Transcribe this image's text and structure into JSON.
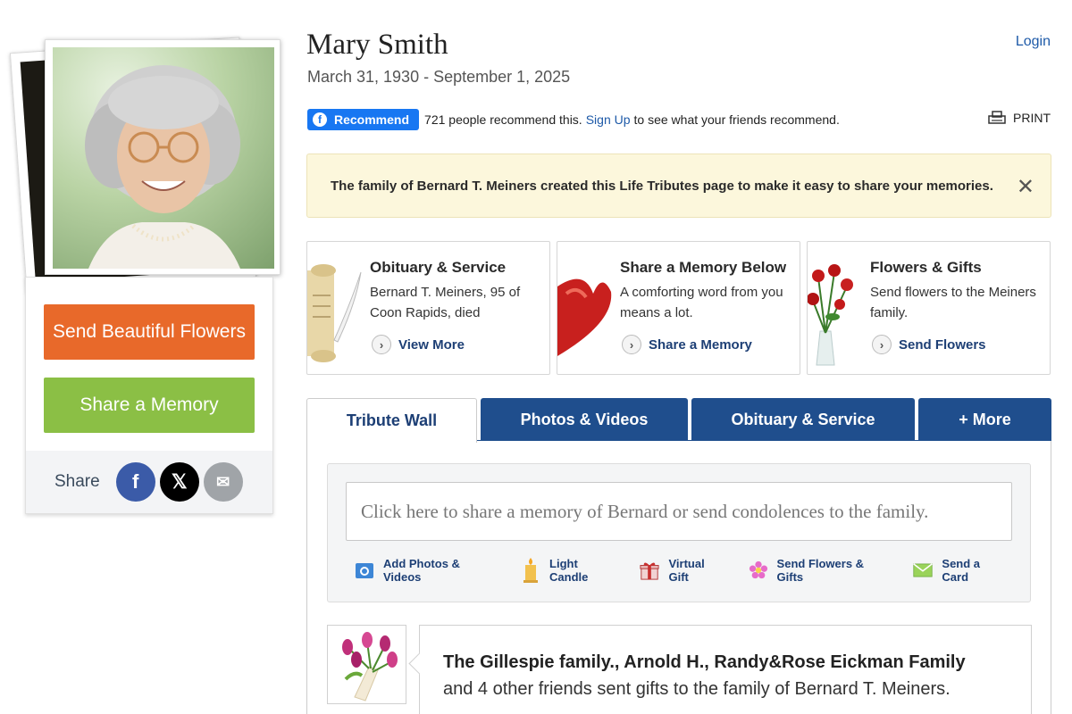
{
  "header": {
    "name": "Mary Smith",
    "dates": "March 31, 1930 - September 1, 2025",
    "login": "Login",
    "print": "PRINT"
  },
  "recommend": {
    "button": "Recommend",
    "text": "721 people recommend this.",
    "signup": "Sign Up",
    "suffix": "to see what your friends recommend."
  },
  "notice": {
    "text": "The family of Bernard T. Meiners created this Life Tributes page to make it easy to share your memories."
  },
  "sidebar": {
    "send_flowers": "Send Beautiful Flowers",
    "share_memory": "Share a Memory",
    "share_label": "Share"
  },
  "cards": [
    {
      "title": "Obituary & Service",
      "desc": "Bernard T. Meiners, 95 of Coon Rapids, died",
      "link": "View More",
      "icon": "scroll-quill-image"
    },
    {
      "title": "Share a Memory Below",
      "desc": "A comforting word from you means a lot.",
      "link": "Share a Memory",
      "icon": "red-heart-image"
    },
    {
      "title": "Flowers & Gifts",
      "desc": "Send flowers to the Meiners family.",
      "link": "Send Flowers",
      "icon": "rose-bouquet-image"
    }
  ],
  "tabs": [
    {
      "label": "Tribute Wall",
      "active": true
    },
    {
      "label": "Photos & Videos",
      "active": false
    },
    {
      "label": "Obituary & Service",
      "active": false
    },
    {
      "label": "+ More",
      "active": false
    }
  ],
  "compose": {
    "placeholder": "Click here to share a memory of Bernard or send condolences to the family."
  },
  "actions": [
    {
      "label": "Add Photos & Videos",
      "icon": "camera-icon"
    },
    {
      "label": "Light Candle",
      "icon": "candle-icon"
    },
    {
      "label": "Virtual Gift",
      "icon": "gift-icon"
    },
    {
      "label": "Send Flowers & Gifts",
      "icon": "flower-icon"
    },
    {
      "label": "Send a Card",
      "icon": "envelope-icon"
    }
  ],
  "gift_post": {
    "title": "The Gillespie family., Arnold H., Randy&Rose Eickman Family",
    "subtitle": "and 4 other friends sent gifts to the family of Bernard T. Meiners."
  },
  "colors": {
    "flowers_button": "#e8692a",
    "memory_button": "#8bbf45",
    "tab_blue": "#1f4e8d",
    "notice_bg": "#fcf7dc"
  }
}
